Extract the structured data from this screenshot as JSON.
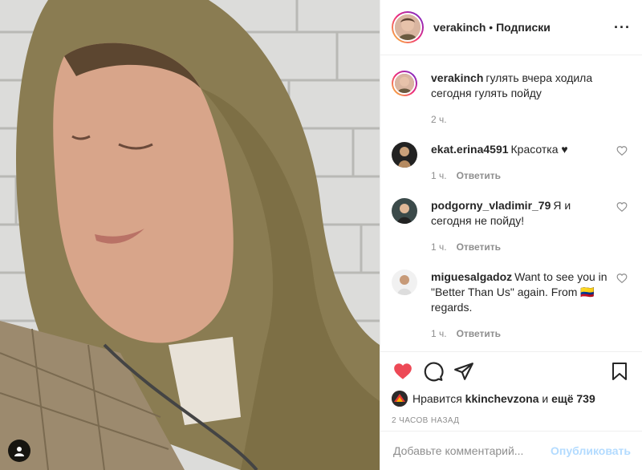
{
  "header": {
    "username": "verakinch",
    "separator": "•",
    "follow_label": "Подписки",
    "more_label": "···"
  },
  "caption": {
    "username": "verakinch",
    "text": "гулять вчера ходила сегодня гулять пойду",
    "time": "2 ч."
  },
  "comments": [
    {
      "username": "ekat.erina4591",
      "text": "Красотка ♥",
      "time": "1 ч.",
      "reply_label": "Ответить"
    },
    {
      "username": "podgorny_vladimir_79",
      "text": "Я и сегодня не пойду!",
      "time": "1 ч.",
      "reply_label": "Ответить"
    },
    {
      "username": "miguesalgadoz",
      "text": "Want to see you in \"Better Than Us\" again. From 🇨🇴 regards.",
      "time": "1 ч.",
      "reply_label": "Ответить"
    }
  ],
  "likes": {
    "prefix": "Нравится",
    "user": "kkinchevzona",
    "conjunction": "и",
    "others": "ещё 739"
  },
  "posted_ago": "2 ЧАСОВ НАЗАД",
  "comment_box": {
    "placeholder": "Добавьте комментарий...",
    "publish_label": "Опубликовать"
  },
  "colors": {
    "like_red": "#ed4956",
    "publish_disabled": "#b3dbff",
    "muted_text": "#8e8e8e",
    "border": "#efefef"
  },
  "icons": [
    "heart-icon",
    "comment-icon",
    "share-icon",
    "bookmark-icon",
    "more-icon",
    "user-tag-icon",
    "comment-like-icon"
  ]
}
